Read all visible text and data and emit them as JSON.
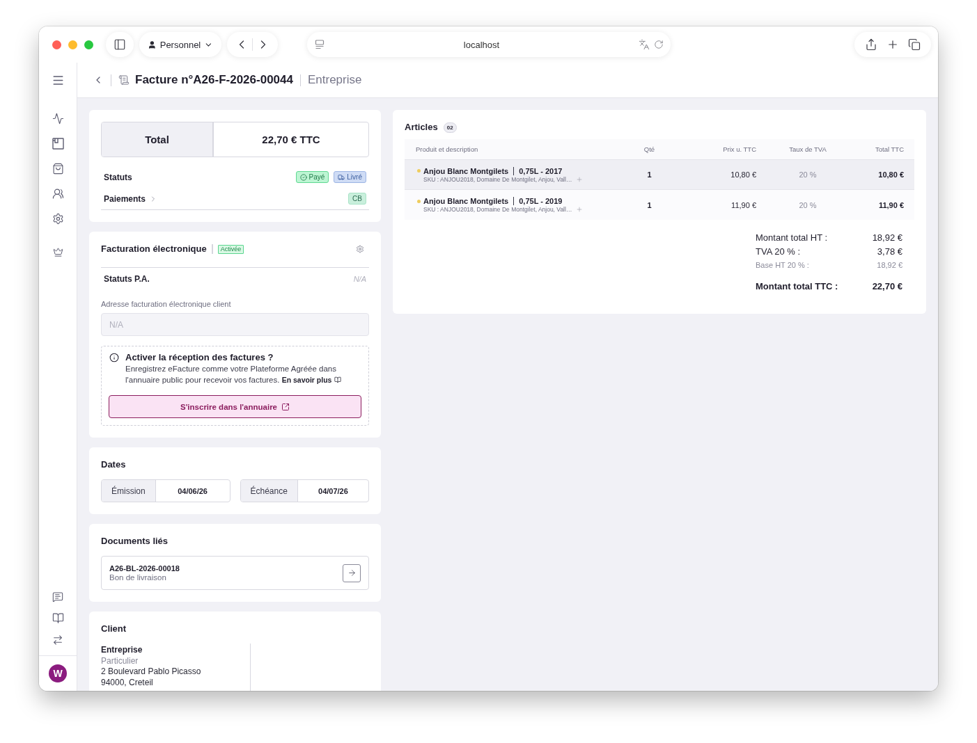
{
  "browser": {
    "profile": "Personnel",
    "address": "localhost"
  },
  "header": {
    "title": "Facture n°A26-F-2026-00044",
    "subtitle": "Entreprise"
  },
  "sidebar": {
    "avatar": "W"
  },
  "summary": {
    "total_label": "Total",
    "total_value": "22,70 € TTC",
    "rows": [
      {
        "kind": "plain",
        "label": "Statuts",
        "badges": [
          {
            "kind": "paid",
            "text": "Payé"
          },
          {
            "kind": "delivered",
            "text": "Livré"
          }
        ]
      },
      {
        "kind": "link",
        "label": "Paiements",
        "badges": [
          {
            "kind": "method",
            "text": "CB"
          }
        ]
      }
    ]
  },
  "e_invoicing": {
    "title": "Facturation électronique",
    "status": "Activée",
    "pa_status": {
      "label": "Statuts P.A.",
      "value": "N/A"
    },
    "address": {
      "label": "Adresse facturation électronique client",
      "placeholder": "N/A"
    },
    "notice": {
      "title": "Activer la réception des factures ?",
      "text": "Enregistrez eFacture comme votre Plateforme Agréée dans l'annuaire public pour recevoir vos factures.",
      "link": "En savoir plus",
      "button": "S'inscrire dans l'annuaire"
    }
  },
  "dates": {
    "title": "Dates",
    "items": [
      {
        "label": "Émission",
        "value": "04/06/26"
      },
      {
        "label": "Échéance",
        "value": "04/07/26"
      }
    ]
  },
  "linked_documents": {
    "title": "Documents liés",
    "items": [
      {
        "number": "A26-BL-2026-00018",
        "type": "Bon de livraison"
      }
    ]
  },
  "client": {
    "title": "Client",
    "name": "Entreprise",
    "type": "Particulier",
    "address_lines": [
      "2 Boulevard Pablo Picasso",
      "94000, Creteil"
    ]
  },
  "articles": {
    "title": "Articles",
    "count": "02",
    "columns": [
      "Produit et description",
      "Qté",
      "Prix u. TTC",
      "Taux de TVA",
      "Total TTC"
    ],
    "rows": [
      {
        "name": "Anjou Blanc Montgilets",
        "variant": "0,75L - 2017",
        "sku": "SKU : ANJOU2018, Domaine De Montgilet, Anjou, Vall…",
        "qty": "1",
        "unit_price": "10,80 €",
        "vat": "20 %",
        "total": "10,80 €",
        "highlighted": true
      },
      {
        "name": "Anjou Blanc Montgilets",
        "variant": "0,75L - 2019",
        "sku": "SKU : ANJOU2018, Domaine De Montgilet, Anjou, Vall…",
        "qty": "1",
        "unit_price": "11,90 €",
        "vat": "20 %",
        "total": "11,90 €",
        "highlighted": false
      }
    ],
    "totals": [
      {
        "kind": "main",
        "label": "Montant total HT :",
        "value": "18,92 €"
      },
      {
        "kind": "main",
        "label": "TVA 20 % :",
        "value": "3,78 €"
      },
      {
        "kind": "sub",
        "label": "Base HT 20 % :",
        "value": "18,92 €"
      },
      {
        "kind": "grand",
        "label": "Montant total TTC :",
        "value": "22,70 €"
      }
    ]
  }
}
